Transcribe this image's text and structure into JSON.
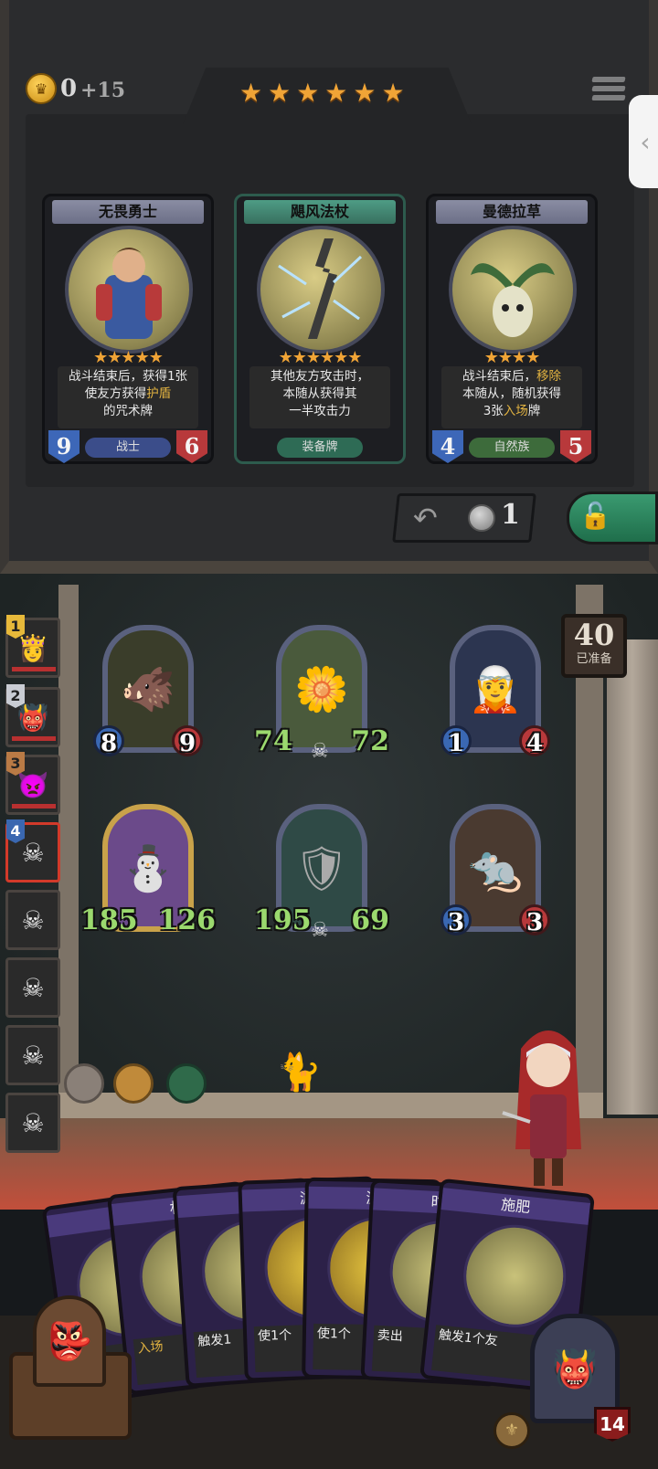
{
  "shop": {
    "gold": "0",
    "gold_income": "+15",
    "tier_stars": "★★★★★★",
    "side_tab_icon": "‹",
    "cards": [
      {
        "name": "无畏勇士",
        "stars": "★★★★★",
        "desc_html": "战斗结束后，获得1张<br>使友方获得<span class='hl'>护盾</span><br>的咒术牌",
        "tribe": "战士",
        "attack": "9",
        "health": "6"
      },
      {
        "name": "飓风法杖",
        "stars": "★★★★★★",
        "desc_html": "其他友方攻击时，<br>本随从获得其<br>一半攻击力",
        "tribe": "装备牌",
        "attack": "",
        "health": ""
      },
      {
        "name": "曼德拉草",
        "stars": "★★★★",
        "desc_html": "战斗结束后，<span class='hl'>移除</span><br>本随从，随机获得<br>3张<span class='hl'>入场</span>牌",
        "tribe": "自然族",
        "attack": "4",
        "health": "5"
      }
    ],
    "refresh_cost": "1"
  },
  "board": {
    "ready_count": "40",
    "ready_label": "已准备",
    "minions": [
      {
        "attack": "8",
        "health": "9",
        "icon": "boar"
      },
      {
        "attack": "74",
        "health": "72",
        "icon": "flower-girl"
      },
      {
        "attack": "1",
        "health": "4",
        "icon": "elf-sorceress"
      },
      {
        "attack": "185",
        "health": "126",
        "icon": "yeti"
      },
      {
        "attack": "195",
        "health": "69",
        "icon": "armored-knight"
      },
      {
        "attack": "3",
        "health": "3",
        "icon": "masked-rat"
      }
    ],
    "opponents": [
      {
        "rank": "1"
      },
      {
        "rank": "2"
      },
      {
        "rank": "3"
      },
      {
        "rank": "4"
      },
      {
        "rank": ""
      },
      {
        "rank": ""
      },
      {
        "rank": ""
      },
      {
        "rank": ""
      }
    ]
  },
  "hand": {
    "cards": [
      {
        "title": "",
        "desc": ""
      },
      {
        "title": "机",
        "desc": "入场"
      },
      {
        "title": "",
        "desc": "触发1"
      },
      {
        "title": "游",
        "desc": "使1个"
      },
      {
        "title": "游",
        "desc": "使1个"
      },
      {
        "title": "时",
        "desc": "卖出"
      },
      {
        "title": "施肥",
        "desc": "触发1个友"
      }
    ],
    "hero_health": "14"
  },
  "colors": {
    "star": "#f0a436",
    "atk_blue": "#3d67b8",
    "hp_red": "#b8393b",
    "buffed_stat_green": "#9bd96e"
  }
}
